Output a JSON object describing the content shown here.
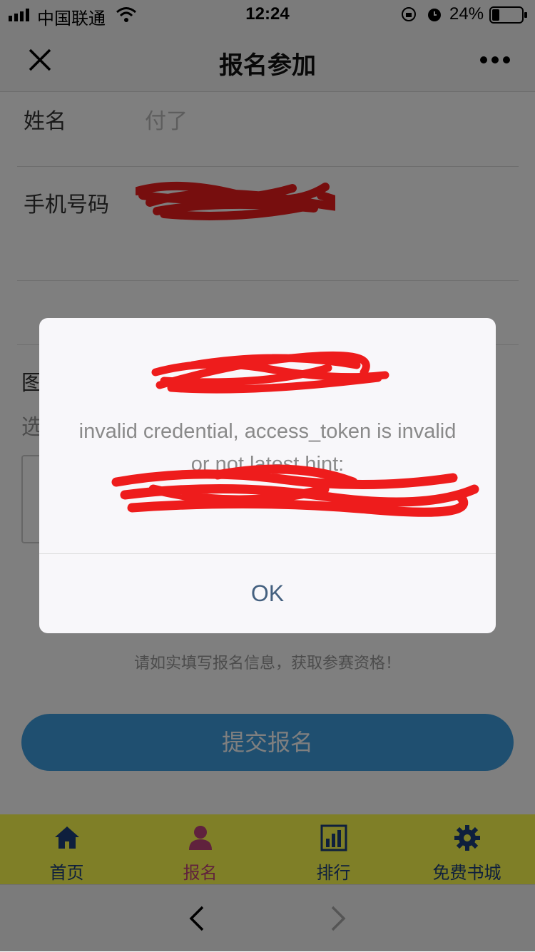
{
  "status_bar": {
    "carrier": "中国联通",
    "time": "12:24",
    "battery": "24%"
  },
  "nav": {
    "title": "报名参加",
    "close_icon": "close-icon",
    "more_icon": "more-icon"
  },
  "form": {
    "name_label": "姓名",
    "name_value": "付了",
    "phone_label": "手机号码",
    "image_label_partial": "图",
    "select_label_partial": "选"
  },
  "hint": "请如实填写报名信息，获取参赛资格！",
  "submit_label": "提交报名",
  "tabs": [
    {
      "label": "首页",
      "icon": "home-icon",
      "active": false
    },
    {
      "label": "报名",
      "icon": "user-icon",
      "active": true
    },
    {
      "label": "排行",
      "icon": "chart-icon",
      "active": false
    },
    {
      "label": "免费书城",
      "icon": "gear-icon",
      "active": false
    }
  ],
  "dialog": {
    "message": "invalid credential, access_token is invalid or not latest hint:",
    "ok_label": "OK"
  },
  "colors": {
    "tab_bar": "#fefe4e",
    "tab_active": "#c0447a",
    "tab_text": "#1c3f7a",
    "submit": "#3f9fe0",
    "redaction": "#ee1c1c",
    "ok_text": "#44607f"
  }
}
